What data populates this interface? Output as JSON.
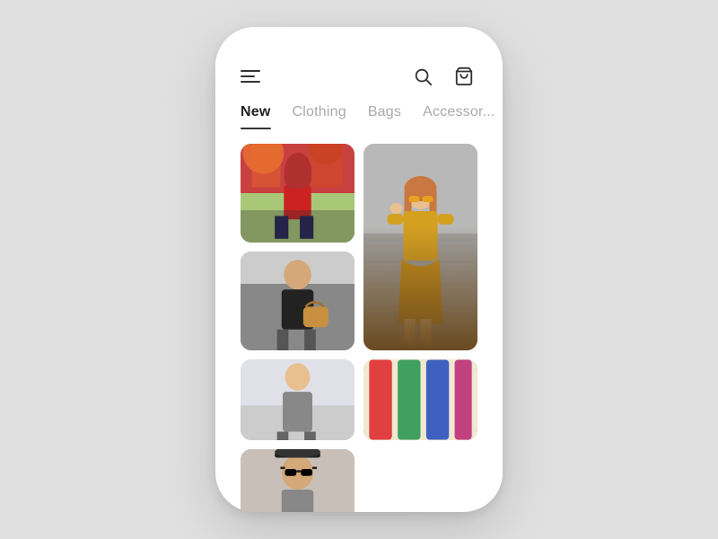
{
  "app": {
    "background_color": "#e0e0e0",
    "phone_bg": "#ffffff"
  },
  "header": {
    "icons": {
      "menu": "menu-icon",
      "search": "search-icon",
      "bag": "bag-icon"
    }
  },
  "navigation": {
    "tabs": [
      {
        "id": "new",
        "label": "New",
        "active": true
      },
      {
        "id": "clothing",
        "label": "Clothing",
        "active": false
      },
      {
        "id": "bags",
        "label": "Bags",
        "active": false
      },
      {
        "id": "accessories",
        "label": "Accessor...",
        "active": false
      }
    ]
  },
  "grid": {
    "items": [
      {
        "id": 1,
        "size": "small",
        "alt": "Woman in red top with autumn trees"
      },
      {
        "id": 2,
        "size": "large",
        "alt": "Woman in yellow outfit sitting on steps"
      },
      {
        "id": 3,
        "size": "small",
        "alt": "Woman in dark jacket with bag"
      },
      {
        "id": 4,
        "size": "small",
        "alt": "Person in winter scene"
      },
      {
        "id": 5,
        "size": "small",
        "alt": "Colorful clothing display"
      },
      {
        "id": 6,
        "size": "small",
        "alt": "Person with hat and sunglasses"
      }
    ]
  }
}
